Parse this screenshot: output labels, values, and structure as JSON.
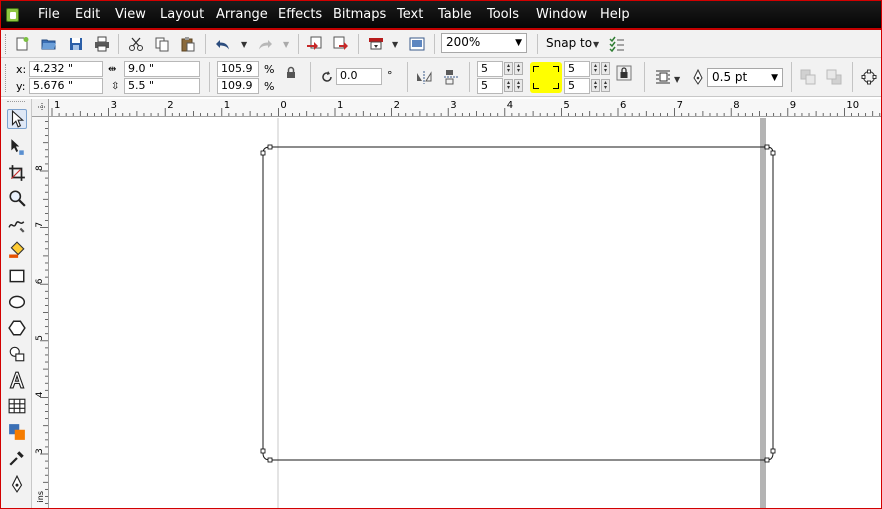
{
  "menubar": {
    "items": [
      {
        "id": "file",
        "label": "File"
      },
      {
        "id": "edit",
        "label": "Edit"
      },
      {
        "id": "view",
        "label": "View"
      },
      {
        "id": "layout",
        "label": "Layout"
      },
      {
        "id": "arrange",
        "label": "Arrange"
      },
      {
        "id": "effects",
        "label": "Effects"
      },
      {
        "id": "bitmaps",
        "label": "Bitmaps"
      },
      {
        "id": "text",
        "label": "Text"
      },
      {
        "id": "table",
        "label": "Table"
      },
      {
        "id": "tools",
        "label": "Tools"
      },
      {
        "id": "window",
        "label": "Window"
      },
      {
        "id": "help",
        "label": "Help"
      }
    ]
  },
  "standard_toolbar": {
    "icons": [
      "new-document-icon",
      "open-icon",
      "save-icon",
      "print-icon",
      "cut-icon",
      "copy-icon",
      "paste-icon",
      "undo-icon",
      "redo-icon",
      "import-icon",
      "export-icon",
      "application-launcher-icon",
      "welcome-screen-icon",
      "snap-options-icon"
    ],
    "zoom_level": "200%",
    "snap_to_label": "Snap to"
  },
  "property_bar": {
    "x_label": "x:",
    "x_value": "4.232 \"",
    "y_label": "y:",
    "y_value": "5.676 \"",
    "width_value": "9.0 \"",
    "height_value": "5.5 \"",
    "scale_x": "105.9",
    "scale_y": "109.9",
    "percent_symbol": "%",
    "rotation_value": "0.0",
    "degree_symbol": "°",
    "corner_left_top": "5",
    "corner_left_bottom": "5",
    "corner_right_top": "5",
    "corner_right_bottom": "5",
    "outline_width": "0.5 pt"
  },
  "colors": {
    "menubar_bg": "#0f0f0f",
    "accent_red": "#c40000",
    "highlight_yellow": "#ffff00",
    "toolbar_bg": "#f2f2f2"
  },
  "rulers": {
    "horizontal_labels": [
      "1",
      "3",
      "2",
      "1",
      "0",
      "1",
      "2",
      "3",
      "4",
      "5",
      "6",
      "7",
      "8",
      "9",
      "10"
    ],
    "vertical_labels": [
      "8",
      "7",
      "6",
      "5",
      "4",
      "3"
    ],
    "unit_label": "inches"
  }
}
